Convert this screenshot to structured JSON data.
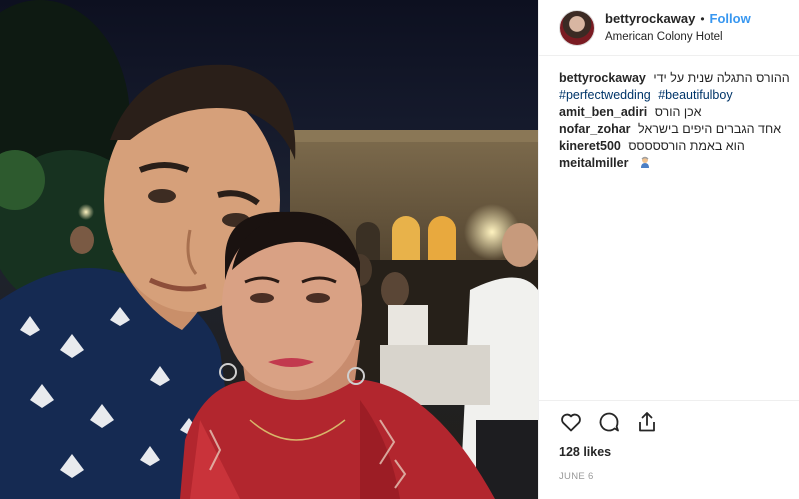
{
  "post": {
    "author": "bettyrockaway",
    "separator": "•",
    "follow_label": "Follow",
    "location": "American Colony Hotel"
  },
  "caption": {
    "user": "bettyrockaway",
    "text": "ההורס התגלה שנית על ידי",
    "hashtags": [
      "#perfectwedding",
      "#beautifulboy"
    ]
  },
  "comments": [
    {
      "user": "amit_ben_adiri",
      "text": "אכן הורס"
    },
    {
      "user": "nofar_zohar",
      "text": "אחד הגברים היפים בישראל"
    },
    {
      "user": "kineret500",
      "text": "הוא באמת הורססססס"
    },
    {
      "user": "meitalmiller",
      "text": "",
      "emoji": "face-emoji"
    }
  ],
  "actions": {
    "icons": [
      "heart-icon",
      "comment-icon",
      "share-icon"
    ],
    "likes": "128 likes",
    "date": "JUNE 6"
  },
  "colors": {
    "link": "#3897f0",
    "hashtag": "#003569",
    "border": "#efefef",
    "muted": "#999999"
  }
}
